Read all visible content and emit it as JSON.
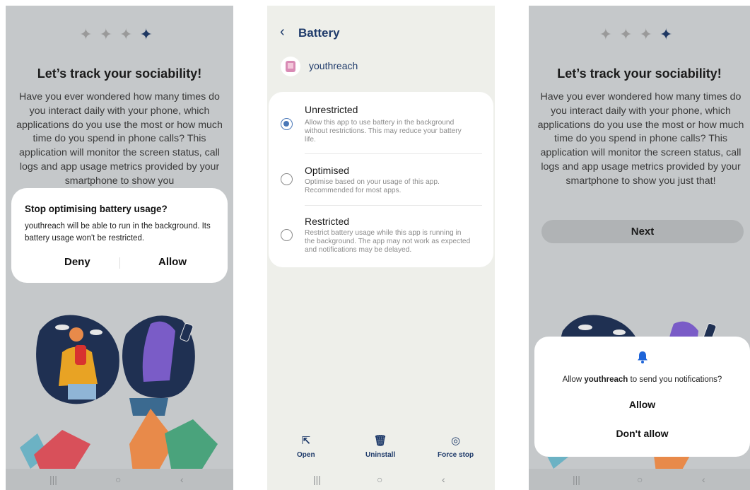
{
  "screen1": {
    "headline": "Let’s track your sociability!",
    "body": "Have you ever wondered how many times do you interact daily with your phone, which applications do you use the most or how much time do you spend in phone calls? This application will monitor the screen status, call logs and app usage metrics provided by your smartphone to show you",
    "dialog": {
      "title": "Stop optimising battery usage?",
      "message": "youthreach will be able to run in the background. Its battery usage won't be restricted.",
      "deny": "Deny",
      "allow": "Allow"
    }
  },
  "screen2": {
    "back_icon": "chevron-left-icon",
    "title": "Battery",
    "app_name": "youthreach",
    "options": [
      {
        "title": "Unrestricted",
        "desc": "Allow this app to use battery in the background without restrictions. This may reduce your battery life.",
        "selected": true
      },
      {
        "title": "Optimised",
        "desc": "Optimise based on your usage of this app. Recommended for most apps.",
        "selected": false
      },
      {
        "title": "Restricted",
        "desc": "Restrict battery usage while this app is running in the background. The app may not work as expected and notifications may be delayed.",
        "selected": false
      }
    ],
    "actions": [
      {
        "label": "Open",
        "icon": "open-icon"
      },
      {
        "label": "Uninstall",
        "icon": "trash-icon"
      },
      {
        "label": "Force stop",
        "icon": "stop-icon"
      }
    ]
  },
  "screen3": {
    "headline": "Let’s track your sociability!",
    "body": "Have you ever wondered how many times do you interact daily with your phone, which applications do you use the most or how much time do you spend in phone calls? This application will monitor the screen status, call logs and app usage metrics provided by your smartphone to show you just that!",
    "next": "Next",
    "dialog": {
      "msg_prefix": "Allow ",
      "app": "youthreach",
      "msg_suffix": " to send you notifications?",
      "allow": "Allow",
      "deny": "Don't allow"
    }
  },
  "colors": {
    "accent": "#1e3a6a",
    "radio": "#4a78b8",
    "bell": "#1e64d8"
  }
}
